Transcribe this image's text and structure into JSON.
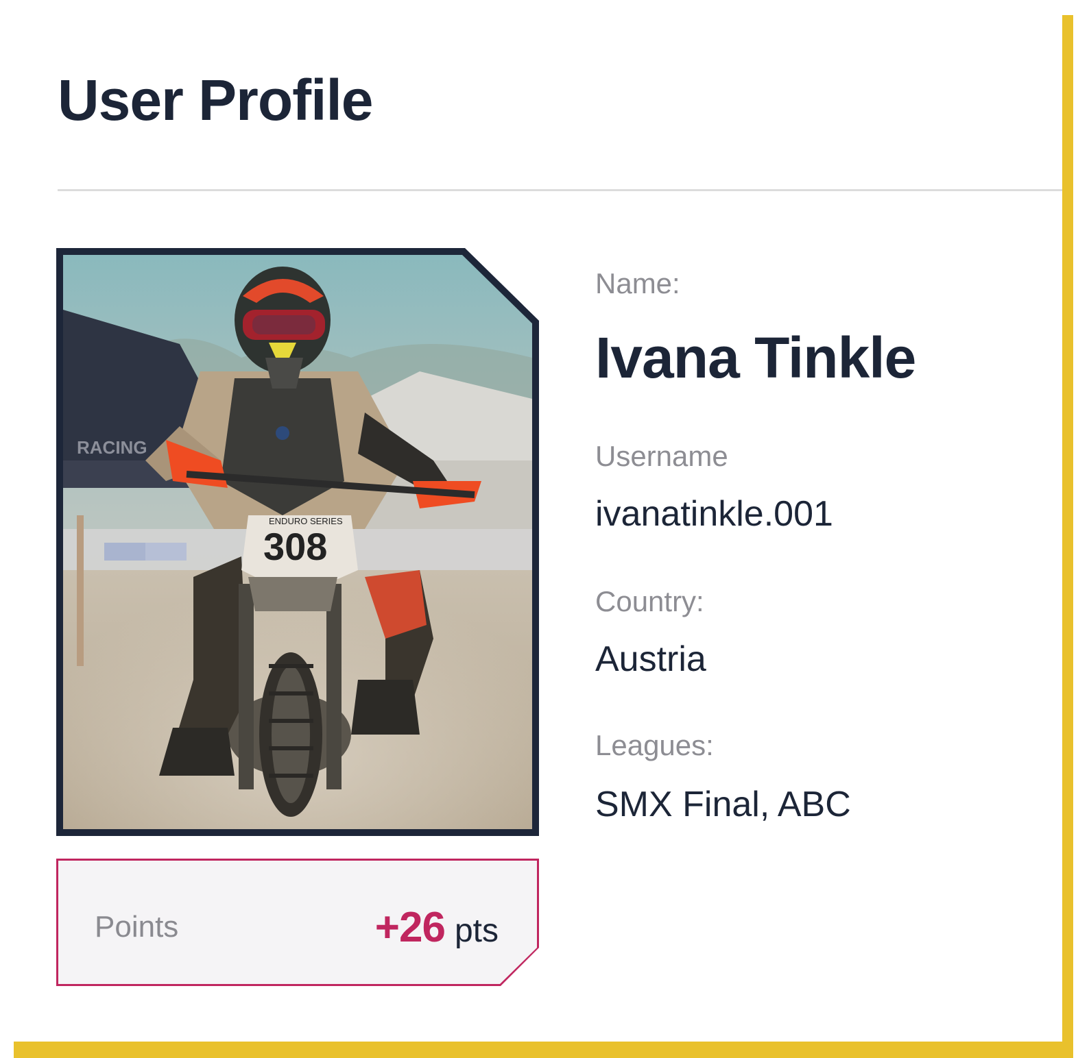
{
  "page": {
    "title": "User Profile"
  },
  "profile": {
    "photo_alt": "Motocross rider on an enduro bike",
    "bike_number": "308",
    "bike_plate_text": "ENDURO SERIES",
    "name_label": "Name:",
    "name_value": "Ivana Tinkle",
    "username_label": "Username",
    "username_value": "ivanatinkle.001",
    "country_label": "Country:",
    "country_value": "Austria",
    "leagues_label": "Leagues:",
    "leagues_value": "SMX Final, ABC"
  },
  "points": {
    "label": "Points",
    "value": "+26",
    "unit": "pts"
  },
  "colors": {
    "accent": "#e9c12c",
    "title": "#1c2537",
    "points": "#c0265f",
    "frame": "#1d2639"
  }
}
